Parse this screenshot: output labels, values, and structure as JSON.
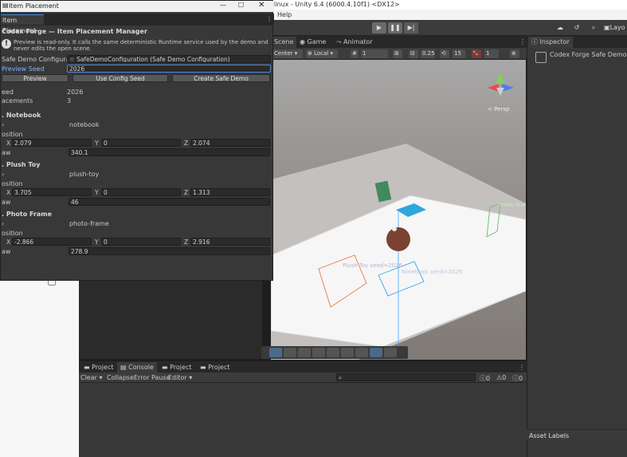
{
  "unity_title": "linux - Unity 6.4 (6000.4.10f1) <DX12>",
  "menu_help": "Help",
  "window": {
    "title": "Item Placement",
    "tab": "Item Placement",
    "heading": "Codex Forge — Item Placement Manager",
    "notice": "Preview is read-only. It calls the same deterministic Runtime service used by the demo and never edits the open scene.",
    "config_label": "Safe Demo Configuration",
    "config_value": "SafeDemoConfiguration (Safe Demo Configuration)",
    "seed_label": "Preview Seed",
    "seed_value": "2026",
    "buttons": {
      "preview": "Preview",
      "use_config": "Use Config Seed",
      "create": "Create Safe Demo"
    },
    "seed_row_label": "eed",
    "seed_row_value": "2026",
    "placements_label": "acements",
    "placements_value": "3",
    "items": [
      {
        "header": ". Notebook",
        "id": "notebook",
        "position_label": "osition",
        "x": "2.079",
        "y": "0",
        "z": "2.074",
        "yaw_label": "aw",
        "yaw": "340.1"
      },
      {
        "header": ". Plush Toy",
        "id": "plush-toy",
        "position_label": "osition",
        "x": "3.705",
        "y": "0",
        "z": "1.313",
        "yaw_label": "aw",
        "yaw": "46"
      },
      {
        "header": ". Photo Frame",
        "id": "photo-frame",
        "position_label": "osition",
        "x": "-2.866",
        "y": "0",
        "z": "2.916",
        "yaw_label": "aw",
        "yaw": "278.9"
      }
    ],
    "axis_x": "X",
    "axis_y": "Y",
    "axis_z": "Z"
  },
  "scene": {
    "tabs": [
      "Scene",
      "Game",
      "Animator"
    ],
    "pivot": "Center",
    "space": "Local",
    "grid_value": "1",
    "snap_value": "0.25",
    "angle_value": "15",
    "scale_value": "1",
    "persp": "< Persp",
    "label_plush": "Plush Toy  seed=2026",
    "label_notebook": "Notebook  seed=2026",
    "label_photo": "Photo Fram"
  },
  "inspector": {
    "tab": "Inspector",
    "title": "Codex Forge Safe Demo (S",
    "asset_labels": "Asset Labels"
  },
  "console": {
    "tabs": [
      "Project",
      "Console",
      "Project",
      "Project"
    ],
    "clear": "Clear",
    "collapse": "Collapse",
    "error_pause": "Error Pause",
    "editor": "Editor",
    "count_info": "0",
    "count_warn": "0",
    "count_error": "0"
  },
  "layout_label": "Layo"
}
